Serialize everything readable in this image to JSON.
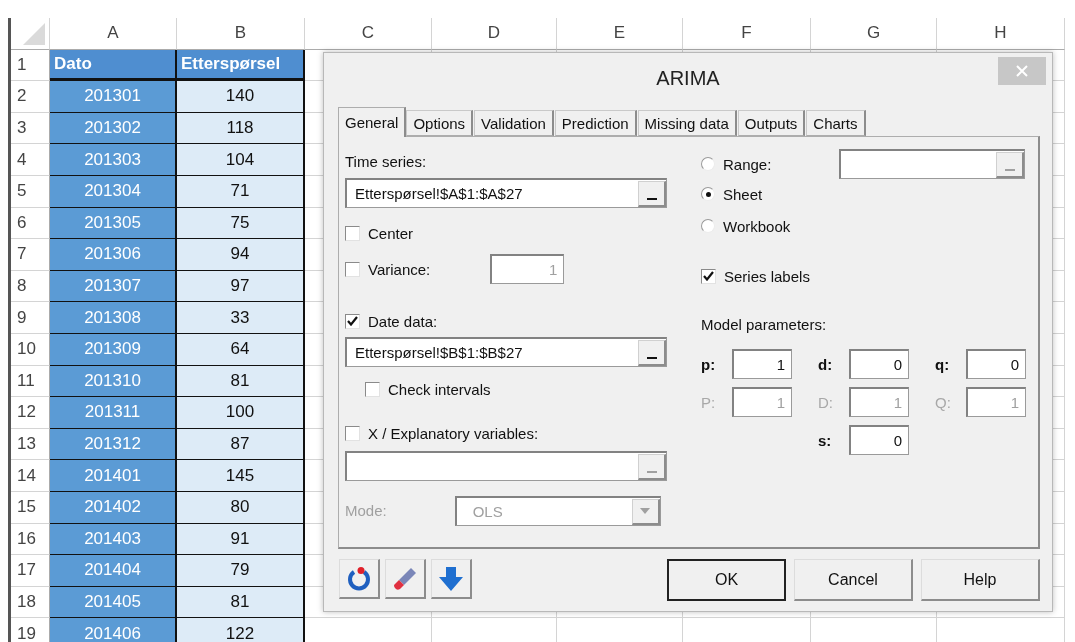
{
  "sheet": {
    "columns": [
      "A",
      "B",
      "C",
      "D",
      "E",
      "F",
      "G",
      "H"
    ],
    "rows": [
      {
        "number": "1",
        "cells": [
          "Dato",
          "Etterspørsel"
        ]
      },
      {
        "number": "2",
        "cells": [
          "201301",
          "140"
        ]
      },
      {
        "number": "3",
        "cells": [
          "201302",
          "118"
        ]
      },
      {
        "number": "4",
        "cells": [
          "201303",
          "104"
        ]
      },
      {
        "number": "5",
        "cells": [
          "201304",
          "71"
        ]
      },
      {
        "number": "6",
        "cells": [
          "201305",
          "75"
        ]
      },
      {
        "number": "7",
        "cells": [
          "201306",
          "94"
        ]
      },
      {
        "number": "8",
        "cells": [
          "201307",
          "97"
        ]
      },
      {
        "number": "9",
        "cells": [
          "201308",
          "33"
        ]
      },
      {
        "number": "10",
        "cells": [
          "201309",
          "64"
        ]
      },
      {
        "number": "11",
        "cells": [
          "201310",
          "81"
        ]
      },
      {
        "number": "12",
        "cells": [
          "201311",
          "100"
        ]
      },
      {
        "number": "13",
        "cells": [
          "201312",
          "87"
        ]
      },
      {
        "number": "14",
        "cells": [
          "201401",
          "145"
        ]
      },
      {
        "number": "15",
        "cells": [
          "201402",
          "80"
        ]
      },
      {
        "number": "16",
        "cells": [
          "201403",
          "91"
        ]
      },
      {
        "number": "17",
        "cells": [
          "201404",
          "79"
        ]
      },
      {
        "number": "18",
        "cells": [
          "201405",
          "81"
        ]
      },
      {
        "number": "19",
        "cells": [
          "201406",
          "122"
        ]
      }
    ]
  },
  "dialog": {
    "title": "ARIMA",
    "tabs": [
      {
        "label": "General",
        "selected": true
      },
      {
        "label": "Options",
        "selected": false
      },
      {
        "label": "Validation",
        "selected": false
      },
      {
        "label": "Prediction",
        "selected": false
      },
      {
        "label": "Missing data",
        "selected": false
      },
      {
        "label": "Outputs",
        "selected": false
      },
      {
        "label": "Charts",
        "selected": false
      }
    ],
    "time_series": {
      "label": "Time series:",
      "value": "Etterspørsel!$A$1:$A$27"
    },
    "center": {
      "label": "Center",
      "checked": false
    },
    "variance": {
      "label": "Variance:",
      "checked": false,
      "value": "1"
    },
    "date_data": {
      "label": "Date data:",
      "checked": true,
      "value": "Etterspørsel!$B$1:$B$27"
    },
    "check_intervals": {
      "label": "Check intervals",
      "checked": false
    },
    "explanatory": {
      "label": "X / Explanatory variables:",
      "checked": false
    },
    "mode": {
      "label": "Mode:",
      "value": "OLS",
      "disabled": true
    },
    "output_targets": [
      {
        "label": "Range:",
        "selected": false
      },
      {
        "label": "Sheet",
        "selected": true
      },
      {
        "label": "Workbook",
        "selected": false
      }
    ],
    "series_labels": {
      "label": "Series labels",
      "checked": true
    },
    "model_parameters": {
      "label": "Model parameters:",
      "grid": [
        {
          "kind": "param",
          "label": "p:",
          "value": "1",
          "disabled": false
        },
        {
          "kind": "param",
          "label": "d:",
          "value": "0",
          "disabled": false
        },
        {
          "kind": "param",
          "label": "q:",
          "value": "0",
          "disabled": false
        },
        {
          "kind": "param",
          "label": "P:",
          "value": "1",
          "disabled": true
        },
        {
          "kind": "param",
          "label": "D:",
          "value": "1",
          "disabled": true
        },
        {
          "kind": "param",
          "label": "Q:",
          "value": "1",
          "disabled": true
        },
        {
          "kind": "gap"
        },
        {
          "kind": "param",
          "label": "s:",
          "value": "0",
          "disabled": false
        },
        {
          "kind": "gap"
        }
      ]
    },
    "buttons": [
      {
        "label": "OK",
        "default": true
      },
      {
        "label": "Cancel",
        "default": false
      },
      {
        "label": "Help",
        "default": false
      }
    ]
  }
}
